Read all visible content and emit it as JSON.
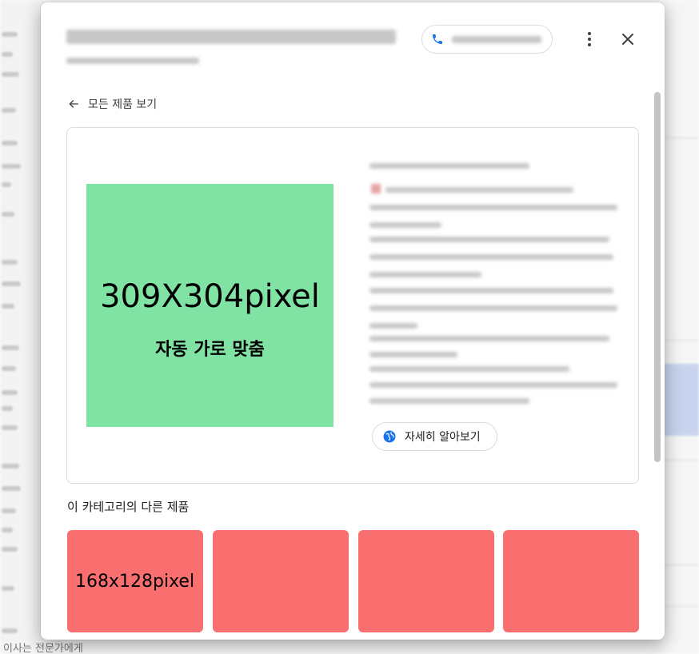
{
  "background": {
    "bottom_text": "이사는 전문가에게"
  },
  "header": {
    "business_name": "",
    "business_subtitle": "",
    "phone_icon": "phone-icon",
    "phone_number": "",
    "more_icon": "more-vert-icon",
    "close_icon": "close-icon"
  },
  "nav": {
    "back_label": "모든 제품 보기",
    "back_icon": "arrow-left-icon"
  },
  "product": {
    "image_size_label": "309X304pixel",
    "image_fit_label": "자동 가로 맞춤",
    "learn_more_label": "자세히 알아보기",
    "learn_more_icon": "globe-icon"
  },
  "related": {
    "heading": "이 카테고리의 다른 제품",
    "items": [
      {
        "label": "168x128pixel"
      },
      {
        "label": ""
      },
      {
        "label": ""
      },
      {
        "label": ""
      }
    ]
  },
  "colors": {
    "main_image_bg": "#80e3a4",
    "thumbnail_bg": "#f96f6f",
    "phone_icon": "#1a73e8",
    "globe_icon": "#1a73e8"
  }
}
